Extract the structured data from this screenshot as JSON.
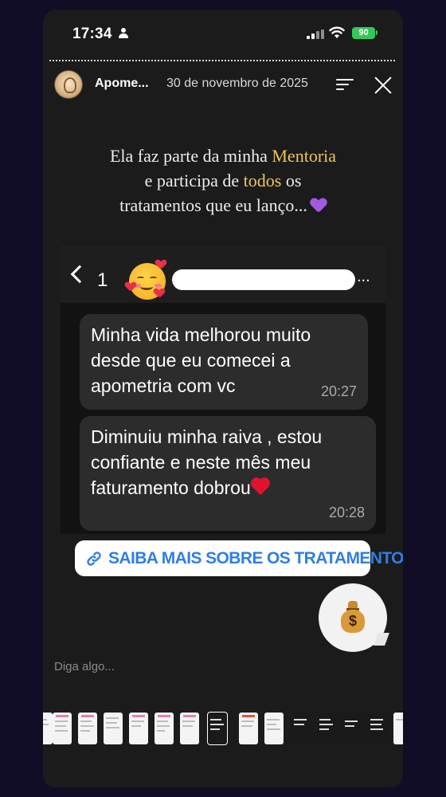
{
  "status_bar": {
    "time": "17:34",
    "battery": "90",
    "icons": [
      "person-icon",
      "signal-icon",
      "wifi-icon",
      "battery-icon"
    ]
  },
  "story_header": {
    "username": "Apome...",
    "date": "30 de novembro de 2025",
    "icons": [
      "menu-icon",
      "close-icon"
    ]
  },
  "caption": {
    "line1_before": "Ela faz parte da minha ",
    "line1_highlight": "Mentoria",
    "line2_before": "e participa de ",
    "line2_highlight": "todos",
    "line2_after": " os",
    "line3": "tratamentos que eu lanço..."
  },
  "chat_screenshot": {
    "back_count": "1",
    "contact_ellipsis": "...",
    "messages": [
      {
        "text": "Minha vida melhorou muito desde que eu comecei a apometria com vc",
        "lines": [
          "Minha vida melhorou muito",
          "desde que eu comecei a",
          "apometria com vc"
        ],
        "time": "20:27"
      },
      {
        "text": "Diminuiu minha raiva , estou confiante e neste mês meu faturamento dobrou",
        "lines": [
          "Diminuiu minha raiva , estou",
          "confiante e neste mês meu",
          "faturamento dobrou"
        ],
        "time": "20:28"
      }
    ]
  },
  "link_sticker": {
    "label": "SAIBA MAIS SOBRE OS TRATAMENTOS",
    "icon": "link-icon"
  },
  "reaction_button": {
    "icon": "money-bag-icon",
    "symbol": "$"
  },
  "reply": {
    "placeholder": "Diga algo..."
  },
  "colors": {
    "highlight": "#f2c45a",
    "link": "#2f7ee6",
    "bubble": "#2c2c2c",
    "battery": "#34c759"
  }
}
